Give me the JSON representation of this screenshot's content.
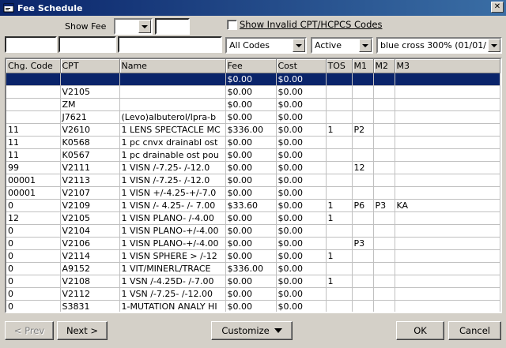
{
  "window": {
    "title": "Fee Schedule",
    "close_glyph": "✕"
  },
  "filters": {
    "show_fee_label": "Show Fee",
    "show_fee_select": "",
    "show_fee_text": "",
    "show_invalid_label": "Show Invalid CPT/HCPCS Codes",
    "show_invalid_checked": false,
    "search_chg_code": "",
    "search_cpt": "",
    "search_name": "",
    "code_filter": "All Codes",
    "status_filter": "Active",
    "fee_schedule": "blue cross 300% (01/01/"
  },
  "grid": {
    "columns": [
      "Chg. Code",
      "CPT",
      "Name",
      "Fee",
      "Cost",
      "TOS",
      "M1",
      "M2",
      "M3"
    ],
    "rows": [
      [
        "",
        "",
        "",
        "$0.00",
        "$0.00",
        "",
        "",
        "",
        ""
      ],
      [
        "",
        "V2105",
        "",
        "$0.00",
        "$0.00",
        "",
        "",
        "",
        ""
      ],
      [
        "",
        "ZM",
        "",
        "$0.00",
        "$0.00",
        "",
        "",
        "",
        ""
      ],
      [
        "",
        "J7621",
        "(Levo)albuterol/Ipra-b",
        "$0.00",
        "$0.00",
        "",
        "",
        "",
        ""
      ],
      [
        "11",
        "V2610",
        "1 LENS SPECTACLE MC",
        "$336.00",
        "$0.00",
        "1",
        "P2",
        "",
        ""
      ],
      [
        "11",
        "K0568",
        "1 pc cnvx drainabl ost",
        "$0.00",
        "$0.00",
        "",
        "",
        "",
        ""
      ],
      [
        "11",
        "K0567",
        "1 pc drainable ost pou",
        "$0.00",
        "$0.00",
        "",
        "",
        "",
        ""
      ],
      [
        "99",
        "V2111",
        "1 VISN  /-7.25- /-12.0",
        "$0.00",
        "$0.00",
        "",
        "12",
        "",
        ""
      ],
      [
        "00001",
        "V2113",
        "1 VISN  /-7.25- /-12.0",
        "$0.00",
        "$0.00",
        "",
        "",
        "",
        ""
      ],
      [
        "00001",
        "V2107",
        "1 VISN +/-4.25-+/-7.0",
        "$0.00",
        "$0.00",
        "",
        "",
        "",
        ""
      ],
      [
        "0",
        "V2109",
        "1 VISN /- 4.25- /- 7.00",
        "$33.60",
        "$0.00",
        "1",
        "P6",
        "P3",
        "KA"
      ],
      [
        "12",
        "V2105",
        "1 VISN PLANO- /-4.00",
        "$0.00",
        "$0.00",
        "1",
        "",
        "",
        ""
      ],
      [
        "0",
        "V2104",
        "1 VISN PLANO-+/-4.00",
        "$0.00",
        "$0.00",
        "",
        "",
        "",
        ""
      ],
      [
        "0",
        "V2106",
        "1 VISN PLANO-+/-4.00",
        "$0.00",
        "$0.00",
        "",
        "P3",
        "",
        ""
      ],
      [
        "0",
        "V2114",
        "1 VISN SPHERE > /-12",
        "$0.00",
        "$0.00",
        "1",
        "",
        "",
        ""
      ],
      [
        "0",
        "A9152",
        "1 VIT/MINERL/TRACE",
        "$336.00",
        "$0.00",
        "",
        "",
        "",
        ""
      ],
      [
        "0",
        "V2108",
        "1 VSN  /-4.25D- /-7.00",
        "$0.00",
        "$0.00",
        "1",
        "",
        "",
        ""
      ],
      [
        "0",
        "V2112",
        "1 VSN  /-7.25- /-12.00",
        "$0.00",
        "$0.00",
        "",
        "",
        "",
        ""
      ],
      [
        "0",
        "S3831",
        "1-MUTATION ANALY HI",
        "$0.00",
        "$0.00",
        "",
        "",
        "",
        ""
      ]
    ],
    "selected_row": 0
  },
  "buttons": {
    "prev": "< Prev",
    "next": "Next >",
    "customize": "Customize",
    "ok": "OK",
    "cancel": "Cancel"
  },
  "icons": {
    "window": "window-icon",
    "dropdown": "chevron-down-icon"
  },
  "colors": {
    "titlebar": "#0a246a",
    "selection": "#0a246a",
    "face": "#d4d0c8"
  }
}
